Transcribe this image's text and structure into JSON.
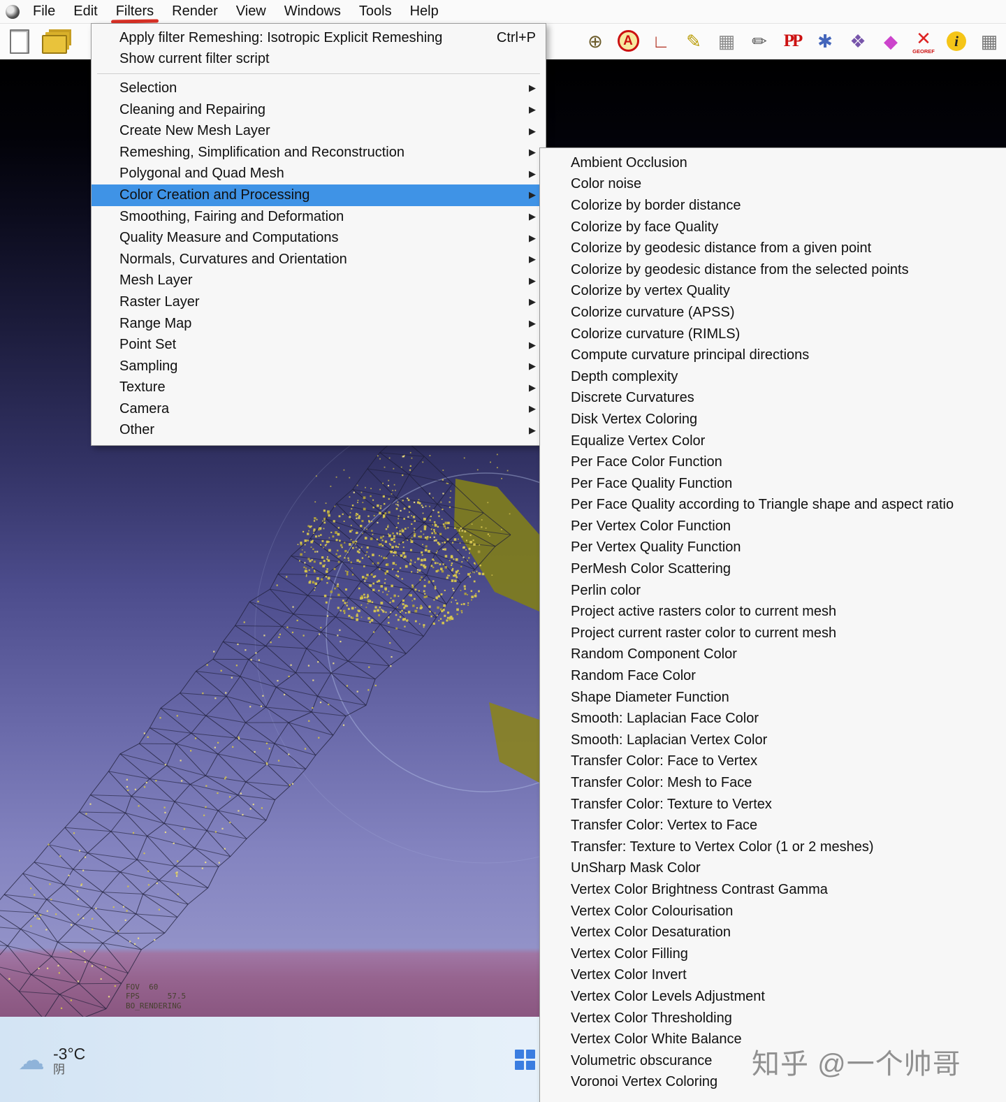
{
  "menubar": {
    "items": [
      {
        "label": "File"
      },
      {
        "label": "Edit"
      },
      {
        "label": "Filters",
        "active": true
      },
      {
        "label": "Render"
      },
      {
        "label": "View"
      },
      {
        "label": "Windows"
      },
      {
        "label": "Tools"
      },
      {
        "label": "Help"
      }
    ]
  },
  "toolbar": {
    "right_icons": [
      {
        "name": "wireframe-sphere-icon",
        "glyph": "⊕",
        "color": "#6b5b2a"
      },
      {
        "name": "text-annotation-icon",
        "glyph": "A",
        "color": "#cc1111",
        "cls": "ring"
      },
      {
        "name": "measure-axis-icon",
        "glyph": "∟",
        "color": "#b03020"
      },
      {
        "name": "fill-color-icon",
        "glyph": "✎",
        "color": "#b89a00"
      },
      {
        "name": "raster-alignment-icon",
        "glyph": "▦",
        "color": "#8a8a8a"
      },
      {
        "name": "paint-brush-icon",
        "glyph": "✏",
        "color": "#555555"
      },
      {
        "name": "pp-filter-icon",
        "glyph": "PP",
        "color": "#cc1111",
        "cls": "serif"
      },
      {
        "name": "point-picking-icon",
        "glyph": "✱",
        "color": "#4466bb"
      },
      {
        "name": "align-points-icon",
        "glyph": "❖",
        "color": "#7755aa"
      },
      {
        "name": "colorize-mesh-icon",
        "glyph": "◆",
        "color": "#cc44cc"
      },
      {
        "name": "georef-icon",
        "glyph": "✕",
        "color": "#dd2222",
        "caption": "GEOREF"
      },
      {
        "name": "info-icon",
        "glyph": "i",
        "color": "#222222",
        "cls": "infodisc"
      },
      {
        "name": "grid-select-icon",
        "glyph": "▦",
        "color": "#777777"
      }
    ]
  },
  "filters_menu": {
    "arrow_glyph": "▶",
    "actions": [
      {
        "label": "Apply filter Remeshing: Isotropic Explicit Remeshing",
        "shortcut": "Ctrl+P"
      },
      {
        "label": "Show current filter script",
        "shortcut": ""
      }
    ],
    "categories": [
      {
        "label": "Selection"
      },
      {
        "label": "Cleaning and Repairing"
      },
      {
        "label": "Create New Mesh Layer"
      },
      {
        "label": "Remeshing, Simplification and Reconstruction"
      },
      {
        "label": "Polygonal and Quad Mesh"
      },
      {
        "label": "Color Creation and Processing",
        "highlighted": true
      },
      {
        "label": "Smoothing, Fairing and Deformation"
      },
      {
        "label": "Quality Measure and Computations"
      },
      {
        "label": "Normals, Curvatures and Orientation"
      },
      {
        "label": "Mesh Layer"
      },
      {
        "label": "Raster Layer"
      },
      {
        "label": "Range Map"
      },
      {
        "label": "Point Set"
      },
      {
        "label": "Sampling"
      },
      {
        "label": "Texture"
      },
      {
        "label": "Camera"
      },
      {
        "label": "Other"
      }
    ]
  },
  "color_submenu": {
    "items": [
      "Ambient Occlusion",
      "Color noise",
      "Colorize by border distance",
      "Colorize by face Quality",
      "Colorize by geodesic distance from a given point",
      "Colorize by geodesic distance from the selected points",
      "Colorize by vertex Quality",
      "Colorize curvature (APSS)",
      "Colorize curvature (RIMLS)",
      "Compute curvature principal directions",
      "Depth complexity",
      "Discrete Curvatures",
      "Disk Vertex Coloring",
      "Equalize Vertex Color",
      "Per Face Color Function",
      "Per Face Quality Function",
      "Per Face Quality according to Triangle shape and aspect ratio",
      "Per Vertex Color Function",
      "Per Vertex Quality Function",
      "PerMesh Color Scattering",
      "Perlin color",
      "Project active rasters color to current mesh",
      "Project current raster color to current mesh",
      "Random Component Color",
      "Random Face Color",
      "Shape Diameter Function",
      "Smooth: Laplacian Face Color",
      "Smooth: Laplacian Vertex Color",
      "Transfer Color: Face to Vertex",
      "Transfer Color: Mesh to Face",
      "Transfer Color: Texture to Vertex",
      "Transfer Color: Vertex to Face",
      "Transfer: Texture to Vertex Color (1 or 2 meshes)",
      "UnSharp Mask Color",
      "Vertex Color Brightness Contrast Gamma",
      "Vertex Color Colourisation",
      "Vertex Color Desaturation",
      "Vertex Color Filling",
      "Vertex Color Invert",
      "Vertex Color Levels Adjustment",
      "Vertex Color Thresholding",
      "Vertex Color White Balance",
      "Volumetric obscurance",
      "Voronoi Vertex Coloring"
    ]
  },
  "viewport": {
    "hud": [
      "FOV  60",
      "FPS      57.5",
      "BO_RENDERING"
    ]
  },
  "taskbar": {
    "weather": {
      "temperature": "-3°C",
      "condition": "阴"
    }
  },
  "watermark": {
    "text": "知乎 @一个帅哥"
  },
  "colors": {
    "menu_highlight": "#3f93e6",
    "annotation_red": "#d93025",
    "mesh_yellow": "#d8c74f",
    "viewport_purple": "#6a6aaa"
  }
}
